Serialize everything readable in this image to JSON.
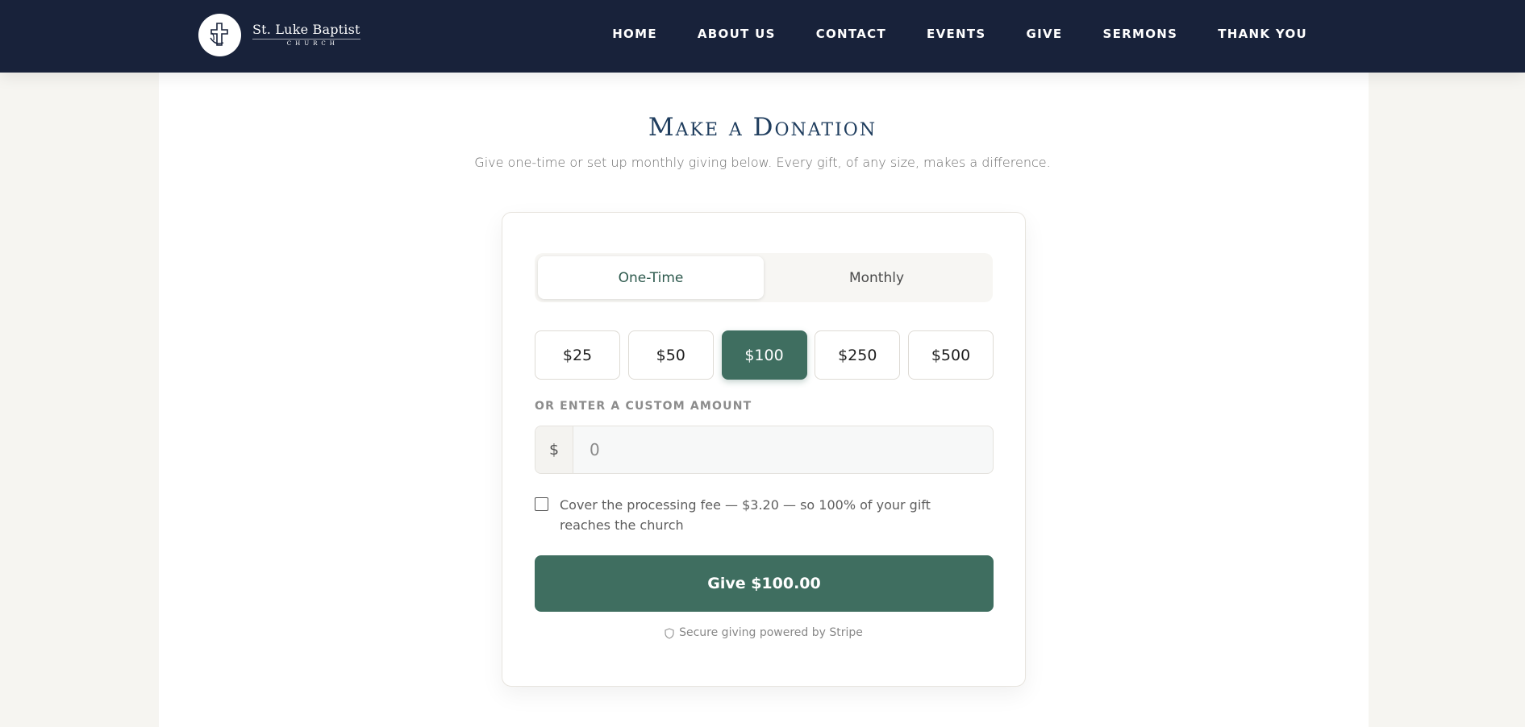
{
  "header": {
    "logo": {
      "name": "St. Luke Baptist",
      "sub": "CHURCH"
    },
    "nav": [
      "HOME",
      "ABOUT US",
      "CONTACT",
      "EVENTS",
      "GIVE",
      "SERMONS",
      "THANK YOU"
    ]
  },
  "main": {
    "title": "Make a Donation",
    "subtitle": "Give one-time or set up monthly giving below. Every gift, of any size, makes a difference.",
    "frequency": {
      "options": [
        "One-Time",
        "Monthly"
      ],
      "selected": "One-Time"
    },
    "amounts": {
      "options": [
        "$25",
        "$50",
        "$100",
        "$250",
        "$500"
      ],
      "selected": "$100"
    },
    "custom": {
      "label": "OR ENTER A CUSTOM AMOUNT",
      "currency": "$",
      "value": "",
      "placeholder": "0"
    },
    "fee": {
      "checked": false,
      "text": "Cover the processing fee — $3.20 — so 100% of your gift reaches the church"
    },
    "give_button": "Give $100.00",
    "secure_text": "Secure giving powered by Stripe"
  },
  "colors": {
    "nav_bg": "#18223a",
    "accent_green": "#3f6e60",
    "title_blue": "#1f3d5e",
    "page_bg": "#f6f5f1"
  }
}
